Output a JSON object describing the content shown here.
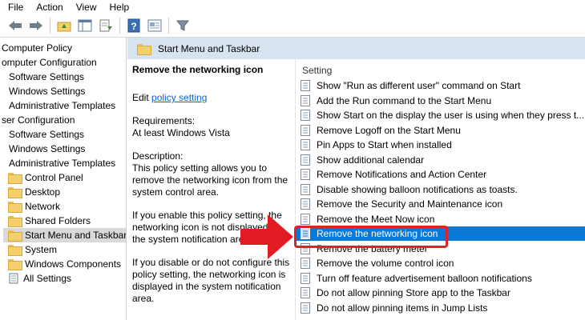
{
  "menubar": {
    "items": [
      "File",
      "Action",
      "View",
      "Help"
    ]
  },
  "toolbar": {
    "buttons": [
      "back-icon",
      "forward-icon",
      "up-folder-icon",
      "show-hide-tree-icon",
      "export-list-icon",
      "help-icon",
      "properties-icon",
      "filter-icon"
    ]
  },
  "tree": {
    "items": [
      {
        "label": "Computer Policy"
      },
      {
        "label": "omputer Configuration"
      },
      {
        "label": "Software Settings"
      },
      {
        "label": "Windows Settings"
      },
      {
        "label": "Administrative Templates"
      },
      {
        "label": "ser Configuration"
      },
      {
        "label": "Software Settings"
      },
      {
        "label": "Windows Settings"
      },
      {
        "label": "Administrative Templates"
      },
      {
        "label": "Control Panel"
      },
      {
        "label": "Desktop"
      },
      {
        "label": "Network"
      },
      {
        "label": "Shared Folders"
      },
      {
        "label": "Start Menu and Taskbar"
      },
      {
        "label": "System"
      },
      {
        "label": "Windows Components"
      },
      {
        "label": "All Settings"
      }
    ]
  },
  "pane": {
    "header_title": "Start Menu and Taskbar"
  },
  "description": {
    "title": "Remove the networking icon",
    "edit_prefix": "Edit ",
    "edit_link": "policy setting",
    "requirements_label": "Requirements:",
    "requirements_value": "At least Windows Vista",
    "description_label": "Description:",
    "description_text": "This policy setting allows you to remove the networking icon from the system control area.",
    "enable_text": "If you enable this policy setting, the networking icon is not displayed in the system notification area.",
    "disable_text": "If you disable or do not configure this policy setting, the networking icon is displayed in the system notification area."
  },
  "settings": {
    "column_header": "Setting",
    "rows": [
      "Show \"Run as different user\" command on Start",
      "Add the Run command to the Start Menu",
      "Show Start on the display the user is using when they press t...",
      "Remove Logoff on the Start Menu",
      "Pin Apps to Start when installed",
      "Show additional calendar",
      "Remove Notifications and Action Center",
      "Disable showing balloon notifications as toasts.",
      "Remove the Security and Maintenance icon",
      "Remove the Meet Now icon",
      "Remove the networking icon",
      "Remove the battery meter",
      "Remove the volume control icon",
      "Turn off feature advertisement balloon notifications",
      "Do not allow pinning Store app to the Taskbar",
      "Do not allow pinning items in Jump Lists"
    ],
    "selected_index": 10
  },
  "colors": {
    "selection": "#0a78d7",
    "header_band": "#d8e3f0",
    "highlight": "#e0202a",
    "link": "#0b63c4"
  }
}
